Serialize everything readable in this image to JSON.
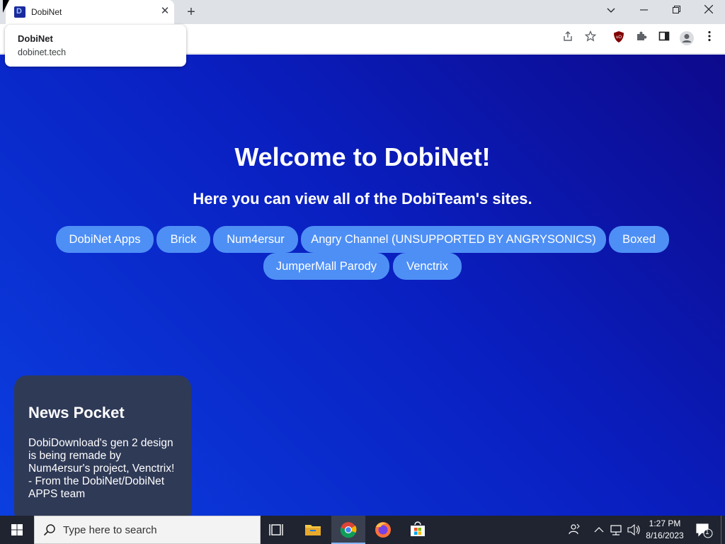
{
  "browser": {
    "tab_title": "DobiNet",
    "tooltip": {
      "title": "DobiNet",
      "url": "dobinet.tech"
    }
  },
  "page": {
    "title": "Welcome to DobiNet!",
    "subtitle": "Here you can view all of the DobiTeam's sites.",
    "buttons": [
      "DobiNet Apps",
      "Brick",
      "Num4ersur",
      "Angry Channel (UNSUPPORTED BY ANGRYSONICS)",
      "Boxed",
      "JumperMall Parody",
      "Venctrix"
    ],
    "news": {
      "title": "News Pocket",
      "body": "DobiDownload's gen 2 design is being remade by Num4ersur's project, Venctrix! - From the DobiNet/DobiNet APPS team"
    }
  },
  "taskbar": {
    "search_placeholder": "Type here to search",
    "time": "1:27 PM",
    "date": "8/16/2023",
    "notification_count": "1"
  },
  "colors": {
    "button_bg": "#4e8ff5",
    "news_bg": "#2f3a57",
    "page_gradient_start": "#0d0a8c",
    "page_gradient_end": "#0b3ee0"
  }
}
